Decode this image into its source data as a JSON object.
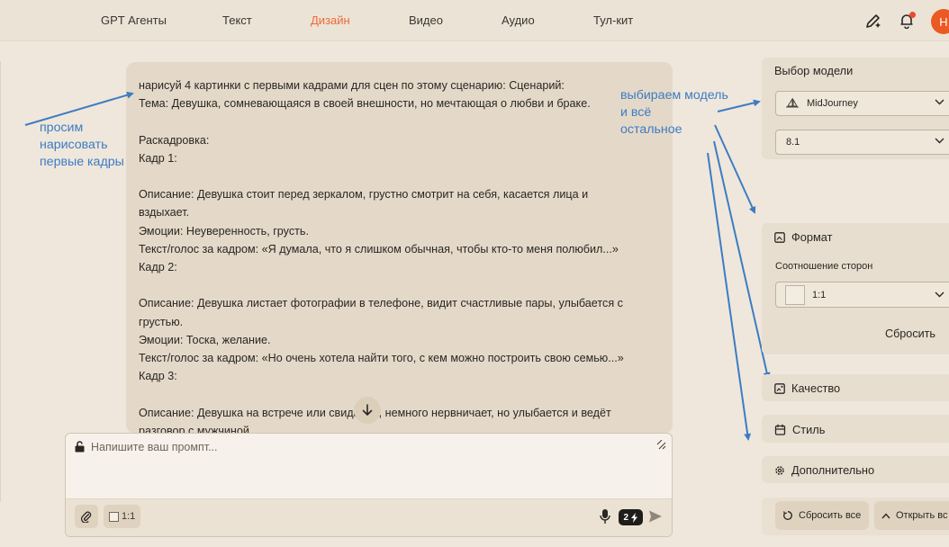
{
  "nav": {
    "items": [
      "GPT Агенты",
      "Текст",
      "Дизайн",
      "Видео",
      "Аудио",
      "Тул-кит"
    ],
    "active": "Дизайн",
    "avatar_letter": "Н"
  },
  "message": {
    "lines": [
      "нарисуй 4 картинки с первыми кадрами для сцен по этому сценарию: Сценарий:",
      "Тема: Девушка, сомневающаяся в своей внешности, но мечтающая о любви и браке.",
      "",
      "Раскадровка:",
      "Кадр 1:",
      "",
      "Описание: Девушка стоит перед зеркалом, грустно смотрит на себя, касается лица и",
      "вздыхает.",
      "Эмоции: Неуверенность, грусть.",
      "Текст/голос за кадром: «Я думала, что я слишком обычная, чтобы кто-то меня полюбил...»",
      "Кадр 2:",
      "",
      "Описание: Девушка листает фотографии в телефоне, видит счастливые пары, улыбается с",
      "грустью.",
      "Эмоции: Тоска, желание.",
      "Текст/голос за кадром: «Но очень хотела найти того, с кем можно построить свою семью...»",
      "Кадр 3:",
      "",
      "Описание: Девушка на встрече или свидании, немного нервничает, но улыбается и ведёт",
      "разговор с мужчиной."
    ]
  },
  "prompt": {
    "placeholder": "Напишите ваш промпт...",
    "ratio_label": "1:1",
    "credits": "2"
  },
  "annotations": {
    "left": [
      "просим",
      "нарисовать",
      "первые кадры"
    ],
    "right": [
      "выбираем модель",
      "и всё",
      "остальное"
    ],
    "color": "#3d7cc2"
  },
  "panel": {
    "model_section": "Выбор модели",
    "model_value": "MidJourney",
    "version_value": "8.1",
    "format_section": "Формат",
    "aspect_label": "Соотношение сторон",
    "aspect_value": "1:1",
    "reset_label": "Сбросить",
    "quality_section": "Качество",
    "style_section": "Стиль",
    "advanced_section": "Дополнительно",
    "reset_all_label": "Сбросить все",
    "open_all_label": "Открыть вс"
  },
  "colors": {
    "accent": "#ee6a35",
    "background": "#efe7dc",
    "message_bg": "#e4d9c9"
  }
}
